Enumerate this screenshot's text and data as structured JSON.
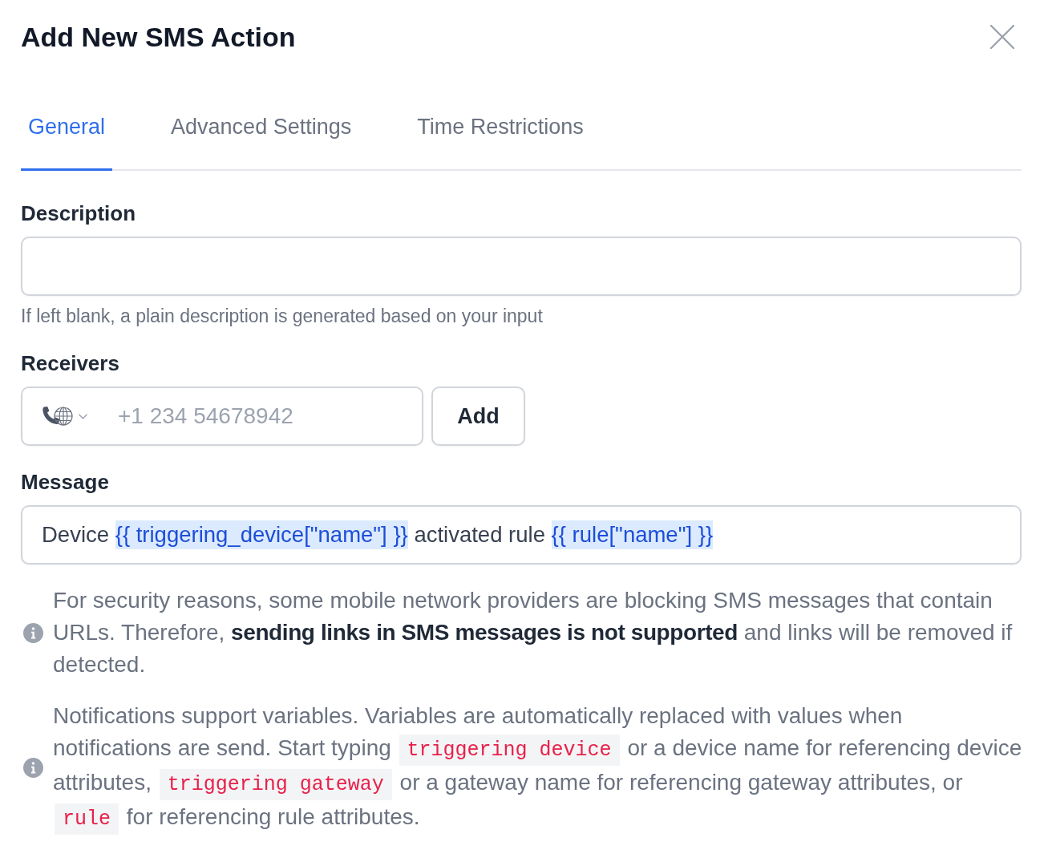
{
  "dialog": {
    "title": "Add New SMS Action"
  },
  "tabs": [
    {
      "label": "General",
      "selected": true
    },
    {
      "label": "Advanced Settings",
      "selected": false
    },
    {
      "label": "Time Restrictions",
      "selected": false
    }
  ],
  "description": {
    "label": "Description",
    "hint": "If left blank, a plain description is generated based on your input"
  },
  "receivers": {
    "label": "Receivers",
    "placeholder": "+1 234 54678942",
    "button": "Add"
  },
  "message": {
    "label": "Message",
    "segments": [
      {
        "kind": "text",
        "text": "Device "
      },
      {
        "kind": "variable",
        "text": "{{ triggering_device[\"name\"] }}"
      },
      {
        "kind": "text",
        "text": " activated rule "
      },
      {
        "kind": "variable",
        "text": "{{ rule[\"name\"] }}"
      }
    ]
  },
  "notes": [
    {
      "segments": [
        {
          "kind": "text",
          "text": "For security reasons, some mobile network providers are blocking SMS messages that contain URLs. Therefore, **sending links in SMS messages is not supported** and links will be removed if detected."
        }
      ]
    },
    {
      "segments": [
        {
          "kind": "text",
          "text": "Notifications support variables. Variables are automatically replaced with values when notifications are send. Start typing "
        },
        {
          "kind": "code",
          "text": "triggering device"
        },
        {
          "kind": "text",
          "text": " or a device name for referencing device attributes, "
        },
        {
          "kind": "code",
          "text": "triggering gateway"
        },
        {
          "kind": "text",
          "text": " or a gateway name for referencing gateway attributes, or "
        },
        {
          "kind": "code",
          "text": "rule"
        },
        {
          "kind": "text",
          "text": " for referencing rule attributes."
        }
      ]
    }
  ]
}
